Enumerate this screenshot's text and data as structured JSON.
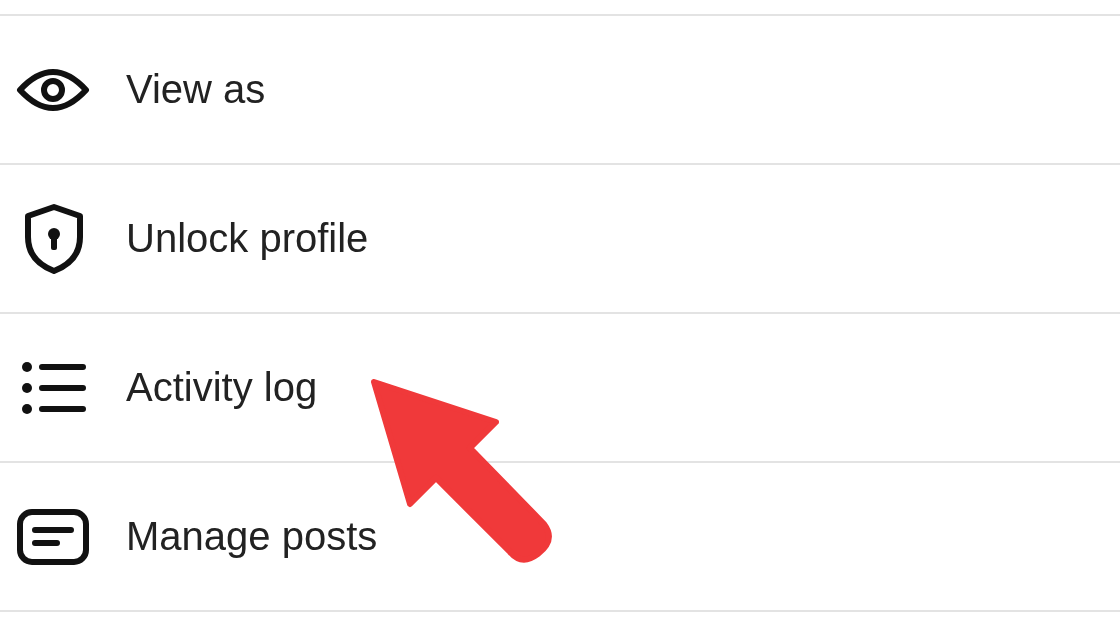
{
  "menu": {
    "items": [
      {
        "label": "View as",
        "kind": "eye"
      },
      {
        "label": "Unlock profile",
        "kind": "shield"
      },
      {
        "label": "Activity log",
        "kind": "list"
      },
      {
        "label": "Manage posts",
        "kind": "posts"
      }
    ]
  }
}
